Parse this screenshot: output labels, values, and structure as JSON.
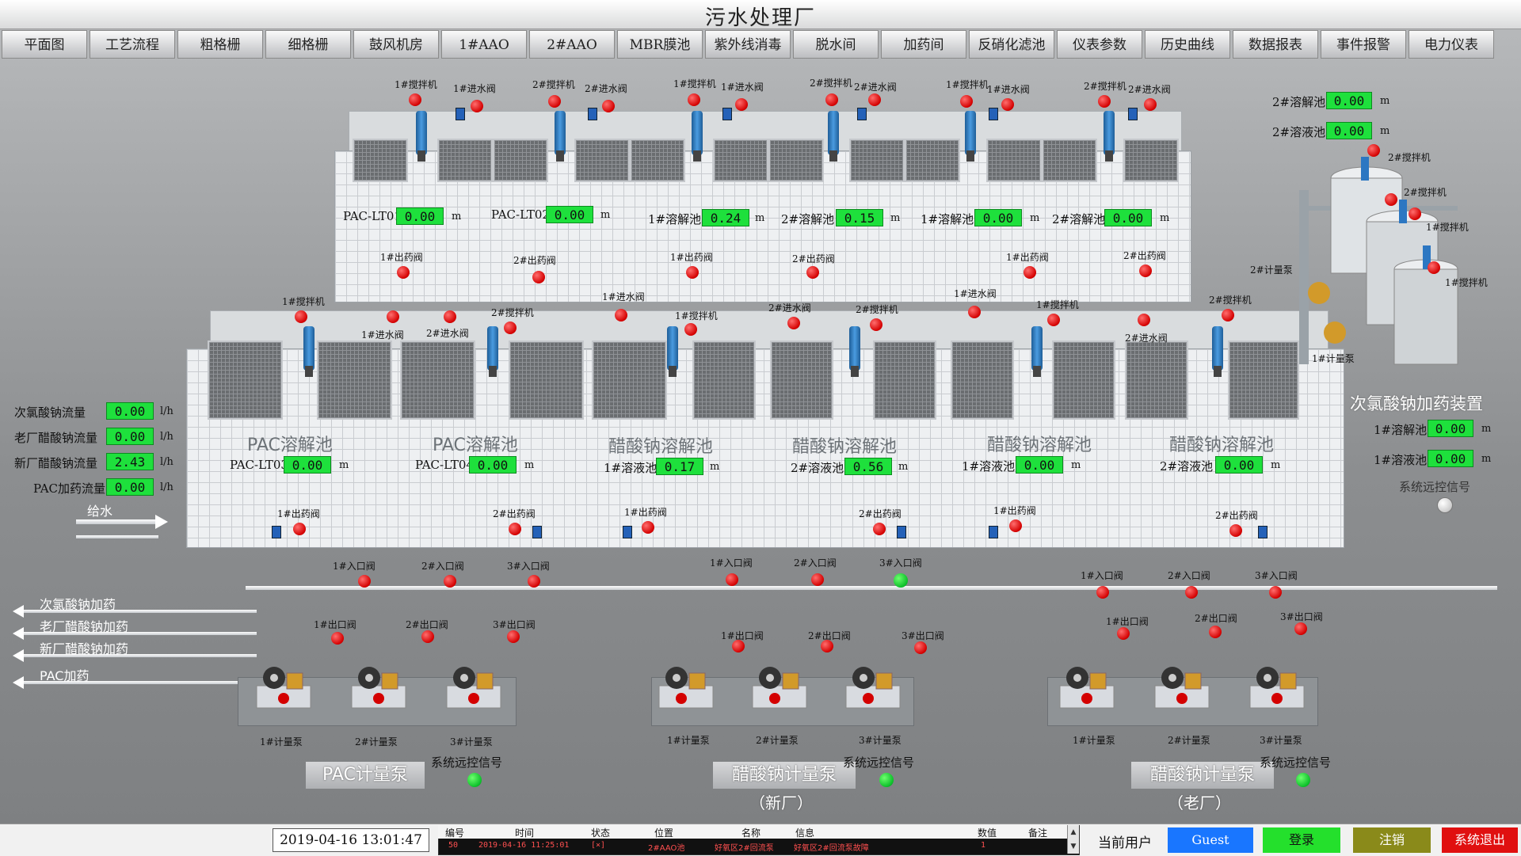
{
  "window": {
    "title": "污水处理厂"
  },
  "nav": [
    "平面图",
    "工艺流程",
    "粗格栅",
    "细格栅",
    "鼓风机房",
    "1#AAO",
    "2#AAO",
    "MBR膜池",
    "紫外线消毒",
    "脱水间",
    "加药间",
    "反硝化滤池",
    "仪表参数",
    "历史曲线",
    "数据报表",
    "事件报警",
    "电力仪表"
  ],
  "upper": {
    "top_labels": [
      "1#搅拌机",
      "1#进水阀",
      "2#搅拌机",
      "2#进水阀",
      "1#搅拌机",
      "1#进水阀",
      "2#搅拌机",
      "2#进水阀",
      "1#搅拌机",
      "1#进水阀",
      "2#搅拌机",
      "2#进水阀"
    ],
    "readings": [
      {
        "label": "PAC-LT01",
        "value": "0.00",
        "unit": "m"
      },
      {
        "label": "PAC-LT02",
        "value": "0.00",
        "unit": "m"
      },
      {
        "label": "1#溶解池",
        "value": "0.24",
        "unit": "m"
      },
      {
        "label": "2#溶解池",
        "value": "0.15",
        "unit": "m"
      },
      {
        "label": "1#溶解池",
        "value": "0.00",
        "unit": "m"
      },
      {
        "label": "2#溶解池",
        "value": "0.00",
        "unit": "m"
      }
    ],
    "outlet_labels": [
      "1#出药阀",
      "2#出药阀",
      "1#出药阀",
      "2#出药阀",
      "1#出药阀",
      "2#出药阀"
    ]
  },
  "lower": {
    "top_labels": [
      "1#搅拌机",
      "1#进水阀",
      "2#进水阀",
      "2#搅拌机",
      "1#进水阀",
      "1#搅拌机",
      "2#进水阀",
      "2#搅拌机",
      "1#进水阀",
      "1#搅拌机",
      "2#进水阀",
      "2#搅拌机"
    ],
    "tanks": [
      {
        "name": "PAC溶解池",
        "label": "PAC-LT03",
        "value": "0.00",
        "unit": "m"
      },
      {
        "name": "PAC溶解池",
        "label": "PAC-LT04",
        "value": "0.00",
        "unit": "m"
      },
      {
        "name": "醋酸钠溶解池",
        "label": "1#溶液池",
        "value": "0.17",
        "unit": "m"
      },
      {
        "name": "醋酸钠溶解池",
        "label": "2#溶液池",
        "value": "0.56",
        "unit": "m"
      },
      {
        "name": "醋酸钠溶解池",
        "label": "1#溶液池",
        "value": "0.00",
        "unit": "m"
      },
      {
        "name": "醋酸钠溶解池",
        "label": "2#溶液池",
        "value": "0.00",
        "unit": "m"
      }
    ],
    "outlet_labels": [
      "1#出药阀",
      "2#出药阀",
      "1#出药阀",
      "2#出药阀",
      "1#出药阀",
      "2#出药阀"
    ]
  },
  "flows": [
    {
      "label": "次氯酸钠流量",
      "value": "0.00",
      "unit": "l/h"
    },
    {
      "label": "老厂醋酸钠流量",
      "value": "0.00",
      "unit": "l/h"
    },
    {
      "label": "新厂醋酸钠流量",
      "value": "2.43",
      "unit": "l/h"
    },
    {
      "label": "PAC加药流量",
      "value": "0.00",
      "unit": "l/h"
    }
  ],
  "feed_label": "给水",
  "outputs": [
    "次氯酸钠加药",
    "老厂醋酸钠加药",
    "新厂醋酸钠加药",
    "PAC加药"
  ],
  "naclo": {
    "title": "次氯酸钠加药装置",
    "top_readings": [
      {
        "label": "2#溶解池",
        "value": "0.00",
        "unit": "m"
      },
      {
        "label": "2#溶液池",
        "value": "0.00",
        "unit": "m"
      }
    ],
    "bottom_readings": [
      {
        "label": "1#溶解池",
        "value": "0.00",
        "unit": "m"
      },
      {
        "label": "1#溶液池",
        "value": "0.00",
        "unit": "m"
      }
    ],
    "equip_labels": [
      "2#搅拌机",
      "2#搅拌机",
      "1#搅拌机",
      "1#搅拌机",
      "2#计量泵",
      "1#计量泵"
    ],
    "remote_label": "系统远控信号"
  },
  "valve_labels": {
    "inlet": [
      "1#入口阀",
      "2#入口阀",
      "3#入口阀"
    ],
    "outlet": [
      "1#出口阀",
      "2#出口阀",
      "3#出口阀"
    ],
    "pumps": [
      "1#计量泵",
      "2#计量泵",
      "3#计量泵"
    ]
  },
  "pump_groups": [
    {
      "name": "PAC计量泵",
      "sub": "",
      "remote": "系统远控信号"
    },
    {
      "name": "醋酸钠计量泵",
      "sub": "（新厂）",
      "remote": "系统远控信号"
    },
    {
      "name": "醋酸钠计量泵",
      "sub": "（老厂）",
      "remote": "系统远控信号"
    }
  ],
  "bottom": {
    "datetime": "2019-04-16 13:01:47",
    "headers": [
      "编号",
      "时间",
      "状态",
      "位置",
      "名称",
      "信息",
      "数值",
      "备注"
    ],
    "row": [
      "50",
      "2019-04-16 11:25:01",
      "[×]",
      "2#AAO池",
      "好氧区2#回流泵",
      "好氧区2#回流泵故障",
      "1",
      ""
    ],
    "user_label": "当前用户",
    "user": "Guest",
    "login": "登录",
    "logout": "注销",
    "exit": "系统退出"
  },
  "colors": {
    "accent_green": "#1ee03c",
    "alarm_red": "#d40000",
    "user_blue": "#1976ff",
    "login_green": "#24e02c",
    "logout_olive": "#8a8a1a",
    "exit_red": "#e01010"
  }
}
